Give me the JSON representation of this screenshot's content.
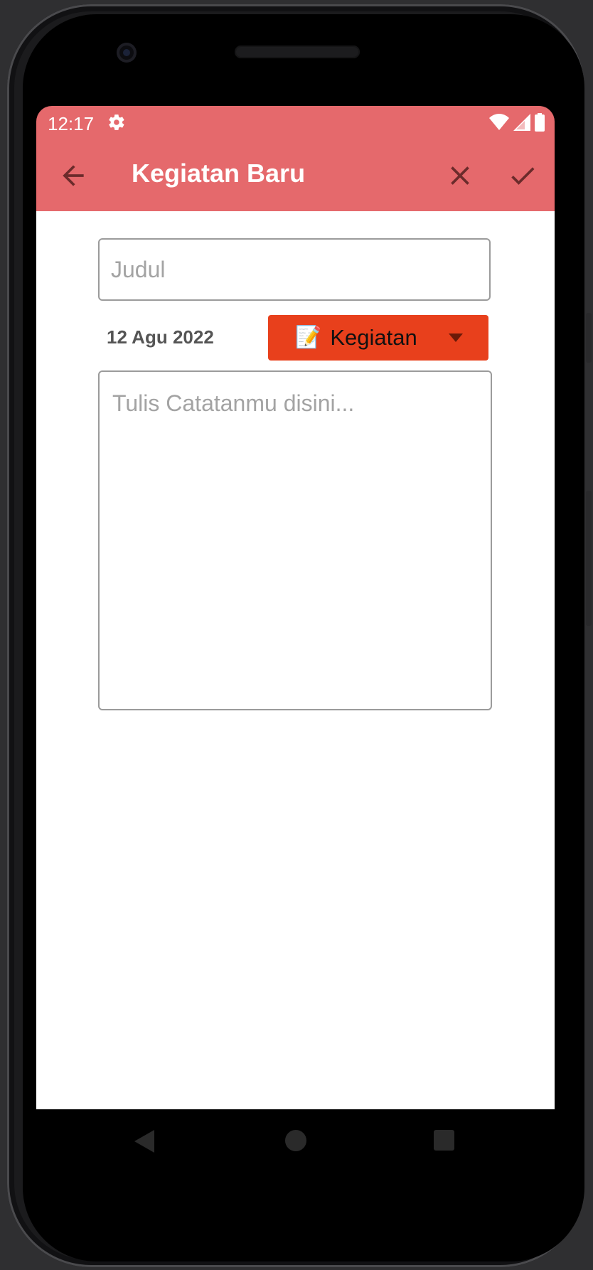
{
  "status_bar": {
    "time": "12:17",
    "icons": [
      "settings-icon",
      "wifi-icon",
      "cellular-icon",
      "battery-icon"
    ]
  },
  "app_bar": {
    "title": "Kegiatan Baru",
    "back_icon": "arrow-back-icon",
    "close_icon": "close-icon",
    "confirm_icon": "check-icon",
    "background_color": "#e5696c"
  },
  "form": {
    "title_placeholder": "Judul",
    "title_value": "",
    "date": "12 Agu 2022",
    "category": {
      "emoji": "📝",
      "label": "Kegiatan",
      "background_color": "#e8401c"
    },
    "note_placeholder": "Tulis Catatanmu disini...",
    "note_value": ""
  },
  "nav_bar": {
    "icons": [
      "nav-back-icon",
      "nav-home-icon",
      "nav-recents-icon"
    ]
  }
}
